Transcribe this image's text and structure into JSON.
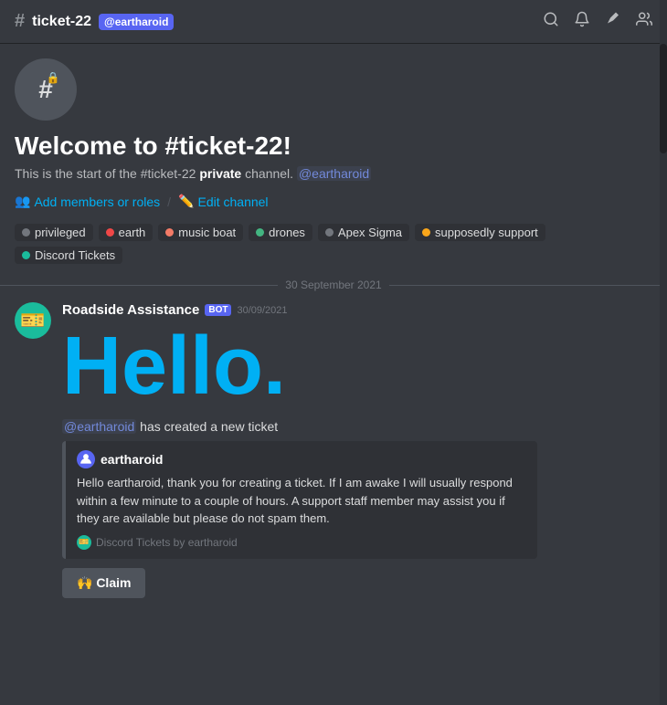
{
  "header": {
    "hash_symbol": "#",
    "channel_name": "ticket-22",
    "user_tag": "@eartharoid",
    "icons": [
      "search",
      "bell",
      "pin",
      "members"
    ]
  },
  "channel_info": {
    "welcome_title": "Welcome to #ticket-22!",
    "welcome_desc_prefix": "This is the start of the #ticket-22",
    "welcome_desc_strong": "private",
    "welcome_desc_suffix": "channel.",
    "welcome_mention": "@eartharoid",
    "action_add": "Add members or roles",
    "action_edit": "Edit channel"
  },
  "roles": [
    {
      "id": "privileged",
      "label": "privileged",
      "color": "#72767d",
      "dot": "#72767d"
    },
    {
      "id": "earth",
      "label": "earth",
      "color": "#dcddde",
      "dot": "#f04747"
    },
    {
      "id": "music-boat",
      "label": "music boat",
      "color": "#dcddde",
      "dot": "#f47b67"
    },
    {
      "id": "drones",
      "label": "drones",
      "color": "#dcddde",
      "dot": "#43b581"
    },
    {
      "id": "apex-sigma",
      "label": "Apex Sigma",
      "color": "#dcddde",
      "dot": "#72767d"
    },
    {
      "id": "supposedly-support",
      "label": "supposedly support",
      "color": "#dcddde",
      "dot": "#faa61a"
    },
    {
      "id": "discord-tickets",
      "label": "Discord Tickets",
      "color": "#dcddde",
      "dot": "#1abc9c"
    }
  ],
  "date_divider": "30 September 2021",
  "message": {
    "author": "Roadside Assistance",
    "bot_label": "BOT",
    "time": "30/09/2021",
    "hello_text": "Hello.",
    "ticket_created_mention": "@eartharoid",
    "ticket_created_text": "has created a new ticket",
    "embed": {
      "author_name": "eartharoid",
      "body": "Hello eartharoid, thank you for creating a ticket. If I am awake I will usually respond within a few minute to a couple of hours. A support staff member may assist you if they are available but please do not spam them.",
      "footer": "Discord Tickets by eartharoid"
    },
    "claim_button": "🙌 Claim"
  }
}
